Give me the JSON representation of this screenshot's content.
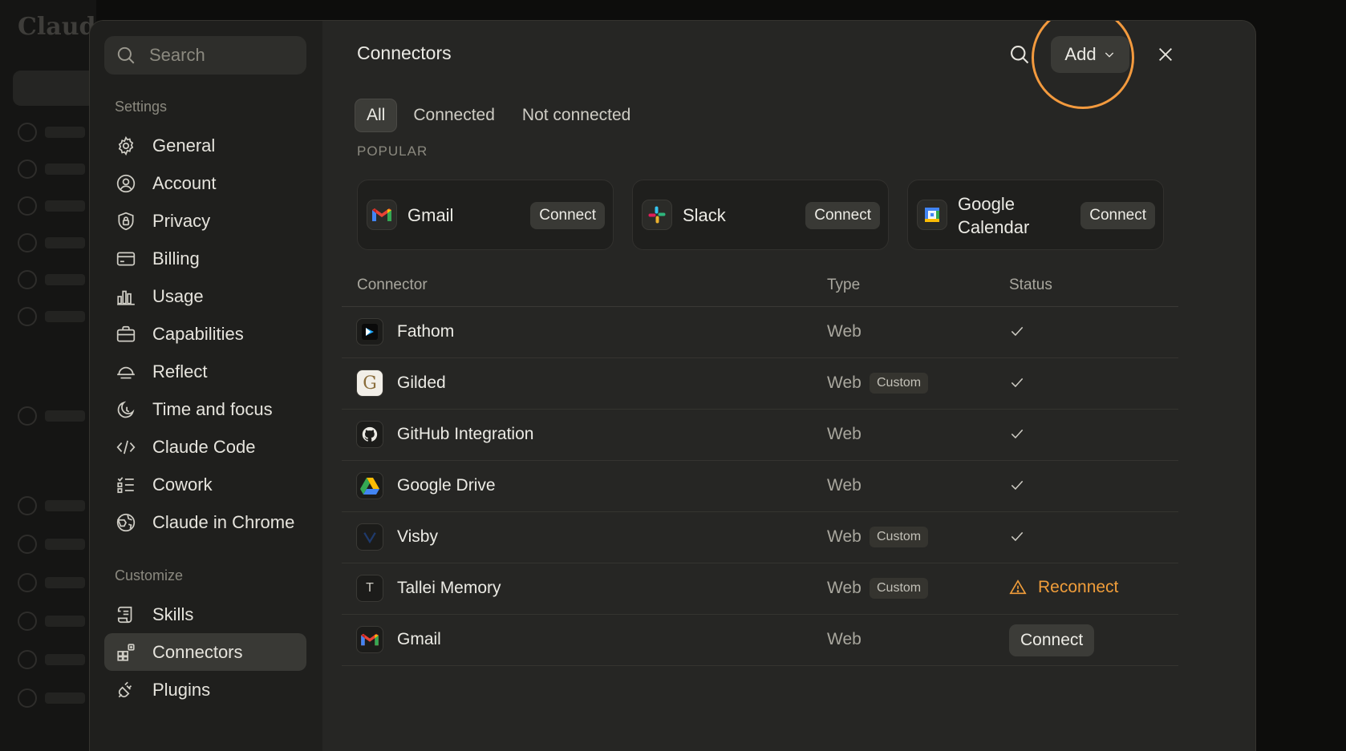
{
  "background": {
    "logo_text": "Claude"
  },
  "sidebar": {
    "search_placeholder": "Search",
    "settings_label": "Settings",
    "settings_items": [
      {
        "label": "General",
        "icon": "gear-icon"
      },
      {
        "label": "Account",
        "icon": "user-circle-icon"
      },
      {
        "label": "Privacy",
        "icon": "shield-lock-icon"
      },
      {
        "label": "Billing",
        "icon": "credit-card-icon"
      },
      {
        "label": "Usage",
        "icon": "bar-chart-icon"
      },
      {
        "label": "Capabilities",
        "icon": "toolbox-icon"
      },
      {
        "label": "Reflect",
        "icon": "sunrise-icon"
      },
      {
        "label": "Time and focus",
        "icon": "moon-clock-icon"
      },
      {
        "label": "Claude Code",
        "icon": "code-icon"
      },
      {
        "label": "Cowork",
        "icon": "checklist-icon"
      },
      {
        "label": "Claude in Chrome",
        "icon": "globe-icon"
      }
    ],
    "customize_label": "Customize",
    "customize_items": [
      {
        "label": "Skills",
        "icon": "scroll-icon"
      },
      {
        "label": "Connectors",
        "icon": "grid-plus-icon",
        "active": true
      },
      {
        "label": "Plugins",
        "icon": "plug-icon"
      }
    ]
  },
  "main": {
    "title": "Connectors",
    "add_label": "Add",
    "tabs": [
      {
        "label": "All",
        "active": true
      },
      {
        "label": "Connected"
      },
      {
        "label": "Not connected"
      }
    ],
    "popular_label": "POPULAR",
    "popular": [
      {
        "name": "Gmail",
        "connect": "Connect",
        "icon": "gmail-icon"
      },
      {
        "name": "Slack",
        "connect": "Connect",
        "icon": "slack-icon"
      },
      {
        "name_line1": "Google",
        "name_line2": "Calendar",
        "connect": "Connect",
        "icon": "google-calendar-icon"
      }
    ],
    "table": {
      "headers": {
        "connector": "Connector",
        "type": "Type",
        "status": "Status"
      },
      "rows": [
        {
          "name": "Fathom",
          "type": "Web",
          "badge": "",
          "status": "connected",
          "icon": "fathom-icon"
        },
        {
          "name": "Gilded",
          "type": "Web",
          "badge": "Custom",
          "status": "connected",
          "icon": "gilded-icon"
        },
        {
          "name": "GitHub Integration",
          "type": "Web",
          "badge": "",
          "status": "connected",
          "icon": "github-icon"
        },
        {
          "name": "Google Drive",
          "type": "Web",
          "badge": "",
          "status": "connected",
          "icon": "google-drive-icon"
        },
        {
          "name": "Visby",
          "type": "Web",
          "badge": "Custom",
          "status": "connected",
          "icon": "visby-icon"
        },
        {
          "name": "Tallei Memory",
          "type": "Web",
          "badge": "Custom",
          "status": "reconnect",
          "status_label": "Reconnect",
          "icon": "tallei-icon",
          "icon_letter": "T"
        },
        {
          "name": "Gmail",
          "type": "Web",
          "badge": "",
          "status": "connect",
          "status_label": "Connect",
          "icon": "gmail-icon"
        }
      ]
    }
  },
  "colors": {
    "accent_highlight": "#f39a3e",
    "warning": "#f09d3a"
  }
}
